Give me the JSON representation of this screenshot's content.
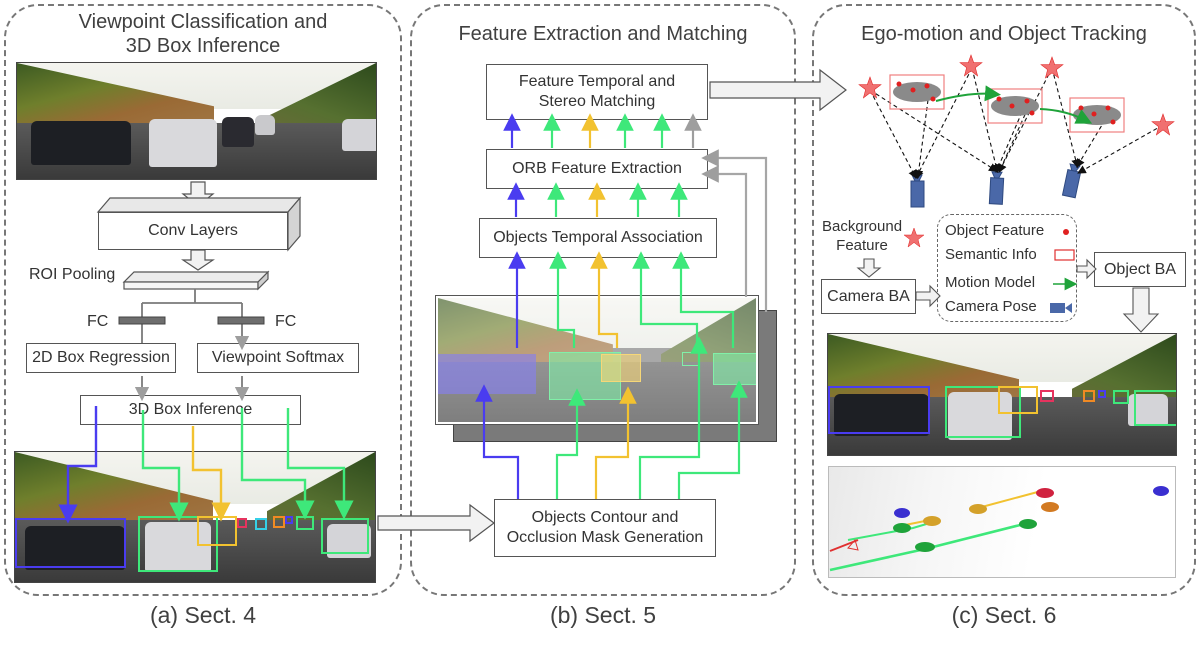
{
  "panels": {
    "a": {
      "title_line1": "Viewpoint Classification and",
      "title_line2": "3D Box Inference",
      "caption": "(a) Sect. 4",
      "conv_layers": "Conv Layers",
      "roi_pooling": "ROI Pooling",
      "fc_left": "FC",
      "fc_right": "FC",
      "box_2d_regression": "2D Box Regression",
      "viewpoint_softmax": "Viewpoint Softmax",
      "box_3d_inference": "3D Box Inference"
    },
    "b": {
      "title": "Feature Extraction and Matching",
      "caption": "(b) Sect. 5",
      "feature_matching_line1": "Feature Temporal and",
      "feature_matching_line2": "Stereo Matching",
      "orb_extraction": "ORB Feature Extraction",
      "temporal_association": "Objects Temporal Association",
      "contour_line1": "Objects Contour and",
      "contour_line2": "Occlusion Mask Generation"
    },
    "c": {
      "title": "Ego-motion and Object Tracking",
      "caption": "(c) Sect. 6",
      "background_feature_line1": "Background",
      "background_feature_line2": "Feature",
      "camera_ba": "Camera BA",
      "object_ba": "Object BA",
      "legend": [
        {
          "label": "Object Feature",
          "icon": "red-dot-icon"
        },
        {
          "label": "Semantic Info",
          "icon": "red-rectangle-icon"
        },
        {
          "label": "Motion Model",
          "icon": "green-arrow-icon"
        },
        {
          "label": "Camera Pose",
          "icon": "camera-icon"
        }
      ]
    }
  },
  "colors": {
    "blue_track": "#4a3cf0",
    "green_track": "#3ee87a",
    "yellow_track": "#f2c230",
    "gray_arrow": "#9e9e9e",
    "star_red": "#e8343c",
    "camera_blue": "#4a68a8",
    "motion_green": "#1fa33a"
  }
}
